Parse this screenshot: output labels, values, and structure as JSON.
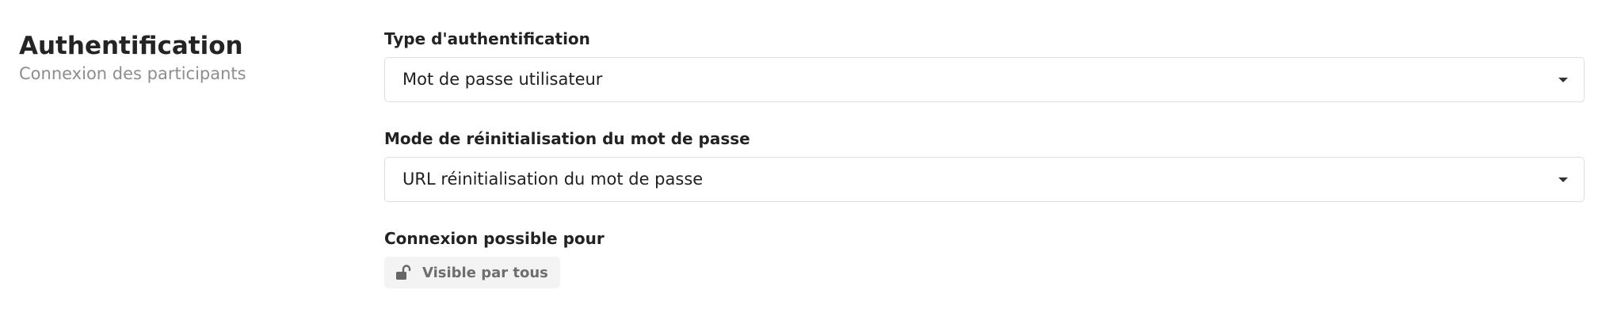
{
  "section": {
    "title": "Authentification",
    "subtitle": "Connexion des participants"
  },
  "fields": {
    "auth_type": {
      "label": "Type d'authentification",
      "value": "Mot de passe utilisateur",
      "icon": "chevron-down-icon"
    },
    "reset_mode": {
      "label": "Mode de réinitialisation du mot de passe",
      "value": "URL réinitialisation du mot de passe",
      "icon": "chevron-down-icon"
    },
    "login_scope": {
      "label": "Connexion possible pour",
      "badge_label": "Visible par tous",
      "icon": "unlocked-padlock-icon"
    }
  },
  "colors": {
    "label": "#222222",
    "subtitle": "#8d8d8d",
    "border": "#dedede",
    "badge_bg": "#f3f3f3",
    "badge_text": "#6e6e6e"
  }
}
